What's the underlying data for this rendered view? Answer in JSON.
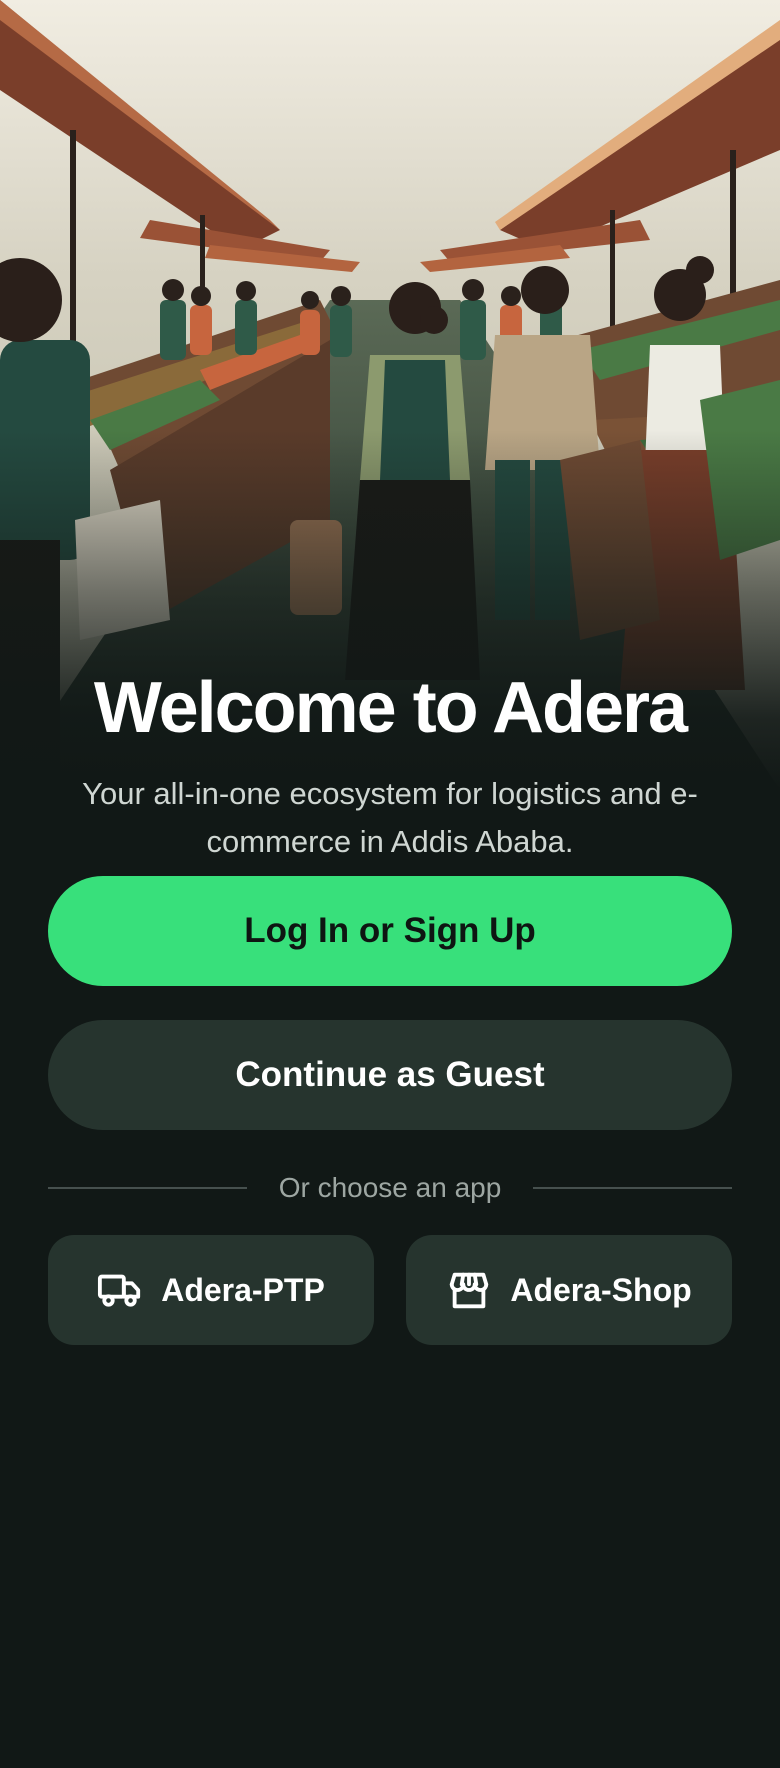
{
  "welcome": {
    "title": "Welcome to Adera",
    "subtitle": "Your all-in-one ecosystem for logistics and e-commerce in Addis Ababa."
  },
  "actions": {
    "primary_label": "Log In or Sign Up",
    "secondary_label": "Continue as Guest"
  },
  "divider": {
    "label": "Or choose an app"
  },
  "apps": [
    {
      "label": "Adera-PTP",
      "icon": "truck-icon"
    },
    {
      "label": "Adera-Shop",
      "icon": "storefront-icon"
    }
  ],
  "colors": {
    "background": "#111816",
    "primary": "#38e07b",
    "secondary_button": "#26342e"
  }
}
